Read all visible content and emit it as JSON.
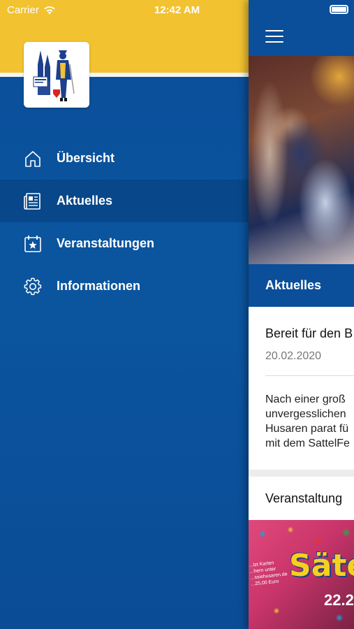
{
  "status_bar": {
    "carrier": "Carrier",
    "time": "12:42 AM"
  },
  "drawer": {
    "menu": [
      {
        "label": "Übersicht",
        "icon": "home-icon",
        "active": false
      },
      {
        "label": "Aktuelles",
        "icon": "newspaper-icon",
        "active": true
      },
      {
        "label": "Veranstaltungen",
        "icon": "calendar-star-icon",
        "active": false
      },
      {
        "label": "Informationen",
        "icon": "gear-icon",
        "active": false
      }
    ]
  },
  "main": {
    "section_title": "Aktuelles",
    "news_card": {
      "title": "Bereit für den B",
      "date": "20.02.2020",
      "body_lines": [
        "Nach einer groß",
        "unvergesslichen",
        "Husaren parat fü",
        "mit dem SattelFe"
      ]
    },
    "events_card": {
      "title": "Veranstaltung"
    },
    "event_image": {
      "banner": "Säte",
      "promo_lines": [
        "...tzt Karten",
        "...hern unter",
        "...ssiehusaren.de",
        "...25,00 Euro"
      ],
      "date": "22.2."
    }
  },
  "colors": {
    "brand_blue": "#0b4e9a",
    "brand_yellow": "#f2c230",
    "text_white": "#ffffff"
  }
}
